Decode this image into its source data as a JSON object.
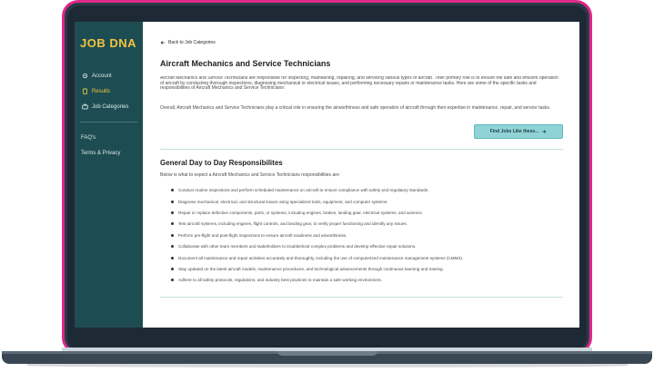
{
  "sidebar": {
    "logo": "JOB DNA",
    "items": [
      {
        "label": "Account",
        "icon": "gear-icon"
      },
      {
        "label": "Results",
        "icon": "clipboard-icon"
      },
      {
        "label": "Job Categories",
        "icon": "briefcase-icon"
      }
    ],
    "secondary": [
      {
        "label": "FAQ's"
      },
      {
        "label": "Terms & Privacy"
      }
    ]
  },
  "main": {
    "back_label": "Back to Job Categories",
    "title": "Aircraft Mechanics and Service Technicians",
    "description_1": "Aircraft Mechanics and Service Technicians are responsible for inspecting, maintaining, repairing, and servicing various types of aircraft. Their primary role is to ensure the safe and efficient operation of aircraft by conducting thorough inspections, diagnosing mechanical or electrical issues, and performing necessary repairs or maintenance tasks. Here are some of the specific tasks and responsibilities of Aircraft Mechanics and Service Technicians:",
    "description_2": "Overall, Aircraft Mechanics and Service Technicians play a critical role in ensuring the airworthiness and safe operation of aircraft through their expertise in maintenance, repair, and service tasks.",
    "find_button": "Find Jobs Like these...",
    "section_title": "General Day to Day Responsibilites",
    "section_intro": "Below is what to expect a Aircraft Mechanics and Service Technicians responsibilities are:",
    "responsibilities": [
      "Conduct routine inspections and perform scheduled maintenance on aircraft to ensure compliance with safety and regulatory standards.",
      "Diagnose mechanical, electrical, and structural issues using specialized tools, equipment, and computer systems.",
      "Repair or replace defective components, parts, or systems, including engines, brakes, landing gear, electrical systems, and avionics.",
      "Test aircraft systems, including engines, flight controls, and landing gear, to verify proper functioning and identify any issues.",
      "Perform pre-flight and post-flight inspections to ensure aircraft readiness and airworthiness.",
      "Collaborate with other team members and stakeholders to troubleshoot complex problems and develop effective repair solutions.",
      "Document all maintenance and repair activities accurately and thoroughly, including the use of computerized maintenance management systems (CMMS).",
      "Stay updated on the latest aircraft models, maintenance procedures, and technological advancements through continuous learning and training.",
      "Adhere to all safety protocols, regulations, and industry best practices to maintain a safe working environment."
    ]
  },
  "colors": {
    "sidebar_bg": "#1d4d52",
    "logo": "#f2c53d",
    "active_nav": "#f2c53d",
    "button_bg": "#8fd3d6",
    "lid_border": "#e0288a"
  }
}
